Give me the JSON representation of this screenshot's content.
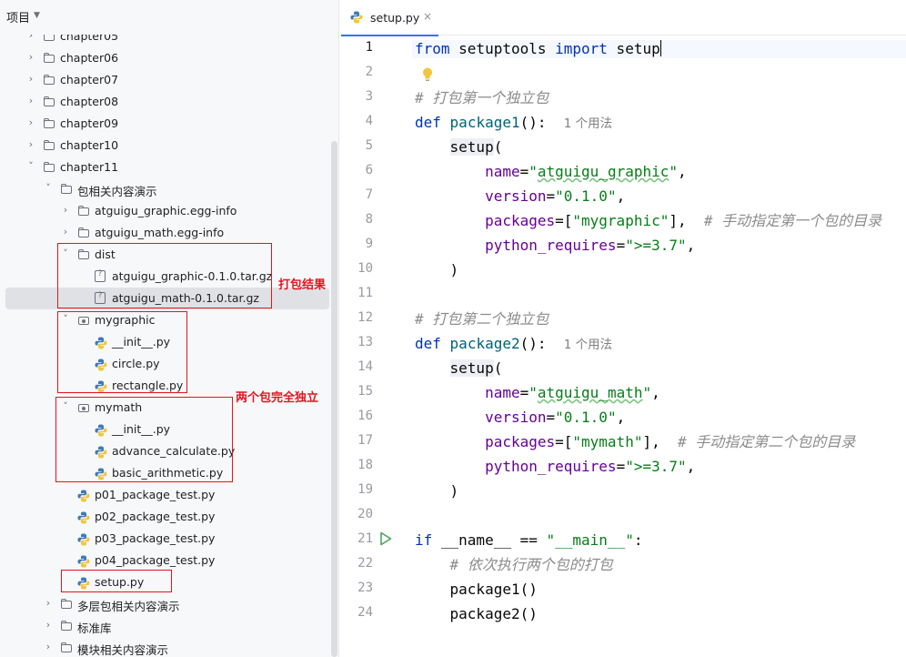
{
  "project": {
    "title": "项目",
    "tree": [
      {
        "label": "chapter05",
        "indent": 0,
        "expandable": true,
        "expanded": false,
        "icon": "folder"
      },
      {
        "label": "chapter06",
        "indent": 0,
        "expandable": true,
        "expanded": false,
        "icon": "folder"
      },
      {
        "label": "chapter07",
        "indent": 0,
        "expandable": true,
        "expanded": false,
        "icon": "folder"
      },
      {
        "label": "chapter08",
        "indent": 0,
        "expandable": true,
        "expanded": false,
        "icon": "folder"
      },
      {
        "label": "chapter09",
        "indent": 0,
        "expandable": true,
        "expanded": false,
        "icon": "folder"
      },
      {
        "label": "chapter10",
        "indent": 0,
        "expandable": true,
        "expanded": false,
        "icon": "folder"
      },
      {
        "label": "chapter11",
        "indent": 0,
        "expandable": true,
        "expanded": true,
        "icon": "folder"
      },
      {
        "label": "包相关内容演示",
        "indent": 1,
        "expandable": true,
        "expanded": true,
        "icon": "folder"
      },
      {
        "label": "atguigu_graphic.egg-info",
        "indent": 2,
        "expandable": true,
        "expanded": false,
        "icon": "folder"
      },
      {
        "label": "atguigu_math.egg-info",
        "indent": 2,
        "expandable": true,
        "expanded": false,
        "icon": "folder"
      },
      {
        "label": "dist",
        "indent": 2,
        "expandable": true,
        "expanded": true,
        "icon": "folder"
      },
      {
        "label": "atguigu_graphic-0.1.0.tar.gz",
        "indent": 3,
        "expandable": false,
        "icon": "unknown-file"
      },
      {
        "label": "atguigu_math-0.1.0.tar.gz",
        "indent": 3,
        "expandable": false,
        "icon": "unknown-file",
        "selected": true
      },
      {
        "label": "mygraphic",
        "indent": 2,
        "expandable": true,
        "expanded": true,
        "icon": "package"
      },
      {
        "label": "__init__.py",
        "indent": 3,
        "expandable": false,
        "icon": "python"
      },
      {
        "label": "circle.py",
        "indent": 3,
        "expandable": false,
        "icon": "python"
      },
      {
        "label": "rectangle.py",
        "indent": 3,
        "expandable": false,
        "icon": "python"
      },
      {
        "label": "mymath",
        "indent": 2,
        "expandable": true,
        "expanded": true,
        "icon": "package"
      },
      {
        "label": "__init__.py",
        "indent": 3,
        "expandable": false,
        "icon": "python"
      },
      {
        "label": "advance_calculate.py",
        "indent": 3,
        "expandable": false,
        "icon": "python"
      },
      {
        "label": "basic_arithmetic.py",
        "indent": 3,
        "expandable": false,
        "icon": "python"
      },
      {
        "label": "p01_package_test.py",
        "indent": 2,
        "expandable": false,
        "icon": "python"
      },
      {
        "label": "p02_package_test.py",
        "indent": 2,
        "expandable": false,
        "icon": "python"
      },
      {
        "label": "p03_package_test.py",
        "indent": 2,
        "expandable": false,
        "icon": "python"
      },
      {
        "label": "p04_package_test.py",
        "indent": 2,
        "expandable": false,
        "icon": "python"
      },
      {
        "label": "setup.py",
        "indent": 2,
        "expandable": false,
        "icon": "python"
      },
      {
        "label": "多层包相关内容演示",
        "indent": 1,
        "expandable": true,
        "expanded": false,
        "icon": "folder"
      },
      {
        "label": "标准库",
        "indent": 1,
        "expandable": true,
        "expanded": false,
        "icon": "folder"
      },
      {
        "label": "模块相关内容演示",
        "indent": 1,
        "expandable": true,
        "expanded": false,
        "icon": "folder"
      }
    ]
  },
  "annotations": {
    "packaging_result": "打包结果",
    "independent": "两个包完全独立"
  },
  "editor": {
    "tab": {
      "label": "setup.py",
      "close": "×"
    },
    "line_numbers": [
      "1",
      "2",
      "3",
      "4",
      "5",
      "6",
      "7",
      "8",
      "9",
      "10",
      "11",
      "12",
      "13",
      "14",
      "15",
      "16",
      "17",
      "18",
      "19",
      "20",
      "21",
      "22",
      "23",
      "24"
    ],
    "usage_hint": "1 个用法",
    "comments": {
      "pkg1": "# 打包第一个独立包",
      "pkg1_dir": "# 手动指定第一个包的目录",
      "pkg2": "# 打包第二个独立包",
      "pkg2_dir": "# 手动指定第二个包的目录",
      "main": "# 依次执行两个包的打包"
    }
  },
  "colors": {
    "annotation": "#e3141f",
    "keyword": "#0033b3",
    "string": "#067d17",
    "function": "#00627a",
    "parameter": "#660099",
    "comment": "#8c8c8c"
  }
}
